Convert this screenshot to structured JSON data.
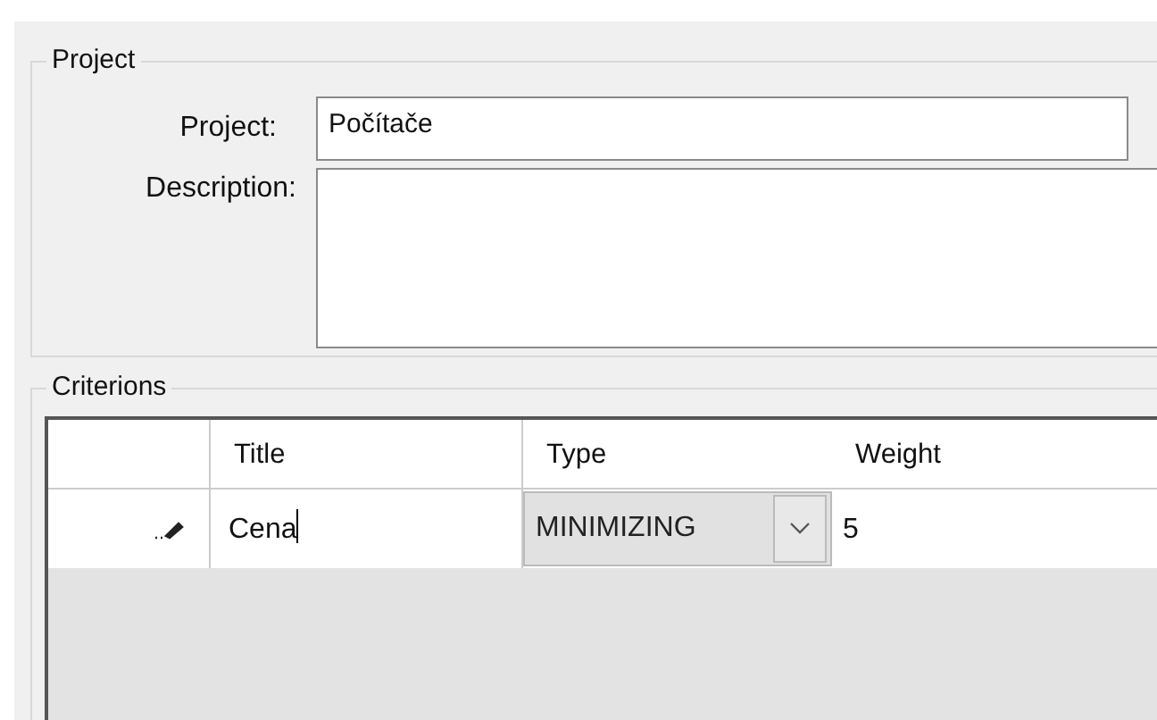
{
  "project_group": {
    "title": "Project",
    "project_label": "Project:",
    "project_value": "Počítače",
    "description_label": "Description:"
  },
  "criterions": {
    "title": "Criterions",
    "columns": [
      "Title",
      "Type",
      "Weight"
    ],
    "rows": [
      {
        "title": "Cena",
        "type": "MINIMIZING",
        "weight": "5",
        "editing": true
      }
    ]
  }
}
